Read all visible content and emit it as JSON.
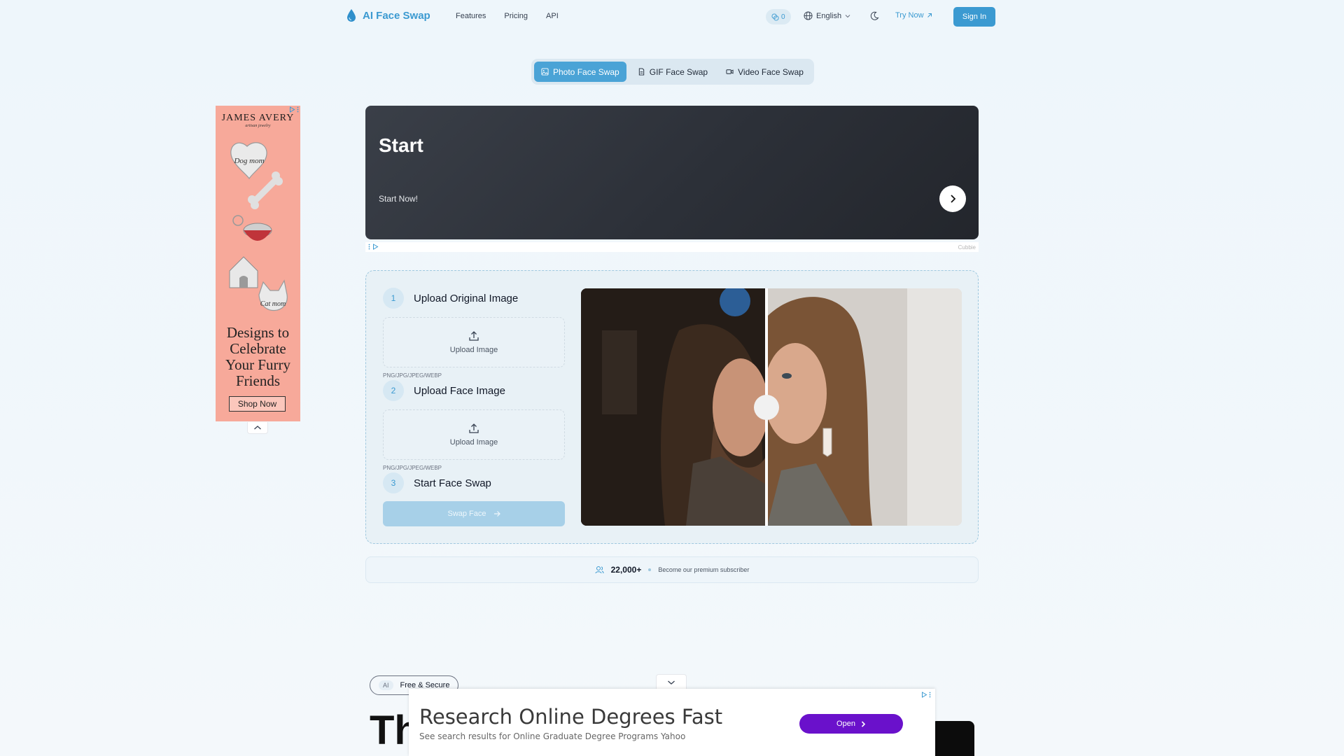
{
  "header": {
    "brand": "AI Face Swap",
    "nav": [
      "Features",
      "Pricing",
      "API"
    ],
    "credits": "0",
    "language": "English",
    "try_now": "Try Now",
    "sign_in": "Sign In",
    "accent_color": "#3b9ad1"
  },
  "mode_tabs": [
    {
      "label": "Photo Face Swap",
      "active": true
    },
    {
      "label": "GIF Face Swap",
      "active": false
    },
    {
      "label": "Video Face Swap",
      "active": false
    }
  ],
  "side_ad": {
    "brand": "JAMES AVERY",
    "brand_sub": "artisan jewelry",
    "charm_1": "Dog mom",
    "charm_2": "Cat mom",
    "headline": "Designs to Celebrate Your Furry Friends",
    "cta": "Shop Now"
  },
  "banner_ad": {
    "title": "Start",
    "subtitle": "Start Now!",
    "footer_brand": "Cubbie"
  },
  "tool": {
    "step1": {
      "num": "1",
      "title": "Upload Original Image",
      "upload_label": "Upload Image",
      "formats": "PNG/JPG/JPEG/WEBP"
    },
    "step2": {
      "num": "2",
      "title": "Upload Face Image",
      "upload_label": "Upload Image",
      "formats": "PNG/JPG/JPEG/WEBP"
    },
    "step3": {
      "num": "3",
      "title": "Start Face Swap"
    },
    "swap_button": "Swap Face"
  },
  "subscribers": {
    "count": "22,000+",
    "text": "Become our premium subscriber"
  },
  "lower": {
    "badge_ai": "AI",
    "badge_label": "Free & Secure",
    "heading_fragment": "Th"
  },
  "anchor_ad": {
    "title": "Research Online Degrees Fast",
    "subtitle": "See search results for Online Graduate Degree Programs Yahoo",
    "button": "Open"
  }
}
